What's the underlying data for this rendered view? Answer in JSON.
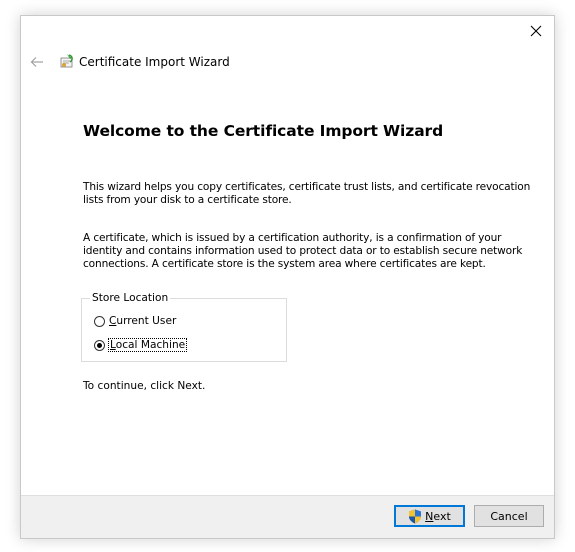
{
  "window": {
    "title": "Certificate Import Wizard",
    "close_icon": "close-icon",
    "back_icon": "back-arrow-icon",
    "wizard_icon": "certificate-wizard-icon"
  },
  "main": {
    "heading": "Welcome to the Certificate Import Wizard",
    "paragraph1": "This wizard helps you copy certificates, certificate trust lists, and certificate revocation lists from your disk to a certificate store.",
    "paragraph2": "A certificate, which is issued by a certification authority, is a confirmation of your identity and contains information used to protect data or to establish secure network connections. A certificate store is the system area where certificates are kept.",
    "store_location": {
      "legend": "Store Location",
      "options": [
        {
          "label_first": "C",
          "label_rest": "urrent User",
          "checked": false
        },
        {
          "label_first": "L",
          "label_rest": "ocal Machine",
          "checked": true
        }
      ]
    },
    "continue_text": "To continue, click Next."
  },
  "footer": {
    "next_first": "N",
    "next_rest": "ext",
    "cancel_label": "Cancel",
    "accent_color": "#0078d7"
  }
}
